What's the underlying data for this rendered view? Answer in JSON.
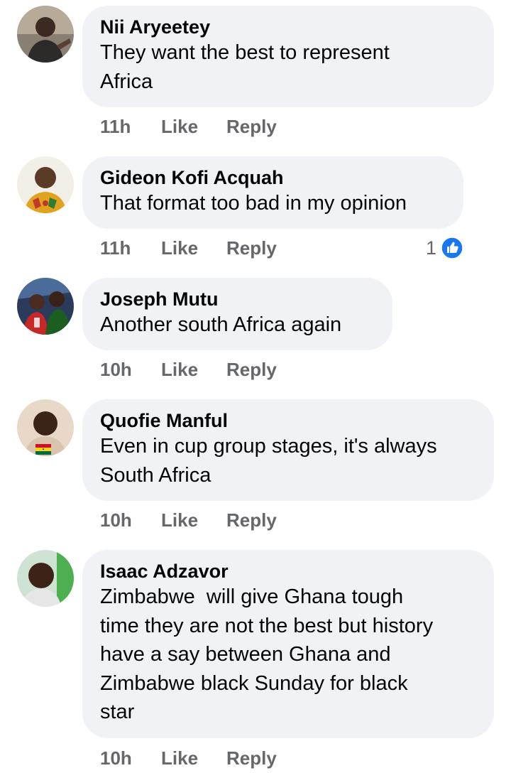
{
  "comments": [
    {
      "name": "Nii Aryeetey",
      "text": "They want the best to represent\nAfrica",
      "time": "11h",
      "like": "Like",
      "reply": "Reply"
    },
    {
      "name": "Gideon Kofi Acquah",
      "text": "That format too bad in my opinion",
      "time": "11h",
      "like": "Like",
      "reply": "Reply",
      "reaction_count": "1",
      "reaction_icon": "like-reaction-icon"
    },
    {
      "name": "Joseph Mutu",
      "text": "Another south Africa again",
      "time": "10h",
      "like": "Like",
      "reply": "Reply"
    },
    {
      "name": "Quofie Manful",
      "text": "Even in cup group stages, it's always\nSouth Africa",
      "time": "10h",
      "like": "Like",
      "reply": "Reply"
    },
    {
      "name": "Isaac Adzavor",
      "text": "Zimbabwe  will give Ghana tough\ntime they are not the best but history\nhave a say between Ghana and\nZimbabwe black Sunday for black\nstar",
      "time": "10h",
      "like": "Like",
      "reply": "Reply"
    }
  ],
  "colors": {
    "bubble": "#f0f2f5",
    "action_text": "#65676b",
    "like_blue": "#1877f2"
  }
}
